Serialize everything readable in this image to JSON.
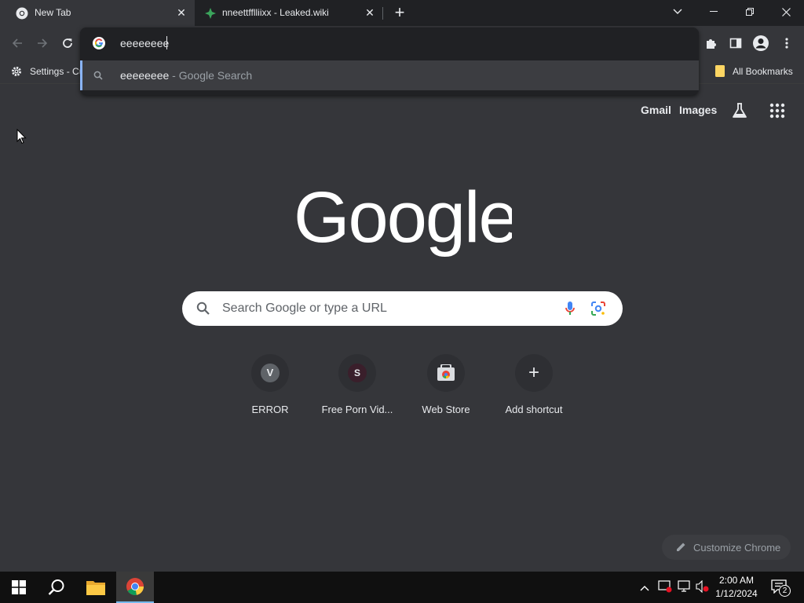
{
  "tabs": [
    {
      "title": "New Tab",
      "active": true,
      "icon": "chrome-icon"
    },
    {
      "title": "nneettfflliixx - Leaked.wiki",
      "active": false,
      "icon": "leaked-wiki-icon"
    }
  ],
  "omnibox": {
    "value": "eeeeeeee",
    "suggestion": {
      "query": "eeeeeeee",
      "suffix": " - Google Search"
    }
  },
  "bookmarks": {
    "first_item": "Settings - Cu",
    "all_bookmarks": "All Bookmarks"
  },
  "ntp": {
    "links": {
      "gmail": "Gmail",
      "images": "Images"
    },
    "search_placeholder": "Search Google or type a URL",
    "shortcuts": [
      {
        "label": "ERROR",
        "letter": "V",
        "color": "#5f6368"
      },
      {
        "label": "Free Porn Vid...",
        "letter": "S",
        "color": "#3a1f2b"
      },
      {
        "label": "Web Store",
        "letter": "",
        "color": "#2e2f33"
      },
      {
        "label": "Add shortcut",
        "letter": "+",
        "color": "#2e2f33"
      }
    ],
    "customize_label": "Customize Chrome"
  },
  "taskbar": {
    "time": "2:00 AM",
    "date": "1/12/2024",
    "notification_count": "2"
  },
  "colors": {
    "tabstrip": "#202124",
    "frame": "#35363a",
    "accent": "#8ab4f8"
  }
}
